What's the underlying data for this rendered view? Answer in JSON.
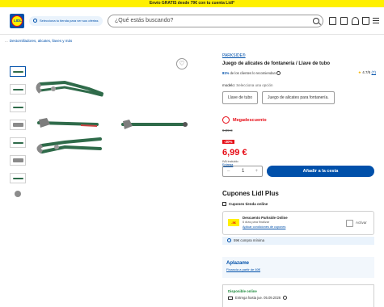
{
  "promo": {
    "text": "Envío GRATIS desde 79€ con tu cuenta Lidl*"
  },
  "header": {
    "logo_text": "LIDL",
    "store_link": "Selecciona tu tienda para ver sus ofertas",
    "search_placeholder": "¿Qué estás buscando?"
  },
  "breadcrumb": {
    "prefix": "...",
    "current": "Destornilladores, alicates, llaves y más"
  },
  "product": {
    "brand": "PARKSIDE®",
    "title": "Juego de alicates de fontanería / Llave de tubo",
    "recommend_pct": "81%",
    "recommend_text": "de los clientes lo recomiendan",
    "rating": "4.7/5",
    "rating_count": "(7)",
    "model_label": "modelo:",
    "model_select": "Selecciona una opción",
    "variants": [
      "Llave de tubo",
      "Juego de alicates para fontanería."
    ]
  },
  "pricing": {
    "badge": "Megadescuento",
    "old_price": "9,99 €",
    "discount": "-30%",
    "price": "6,99 €",
    "vat": "IVA incluido",
    "shipping": "Entrega"
  },
  "cart": {
    "qty": "1",
    "minus": "–",
    "plus": "+",
    "add_label": "Añadir a la cesta"
  },
  "coupons": {
    "title": "Cupones Lidl Plus",
    "subtitle": "Cupones tienda online",
    "tag": "-5€",
    "name": "Descuento Parkside Online",
    "days": "6 días para finalizar",
    "conditions": "Aplicar condiciones de cupones",
    "activate": "Activar",
    "minimum": "59€ compra mínima"
  },
  "aplazame": {
    "logo": "Aplazame",
    "link": "Financia a partir de 60€"
  },
  "availability": {
    "status": "Disponible online",
    "delivery": "Entrega hasta jue. 05.09.2026"
  },
  "colors": {
    "lidl_blue": "#0050aa",
    "lidl_yellow": "#fff000",
    "lidl_red": "#e60a14"
  }
}
